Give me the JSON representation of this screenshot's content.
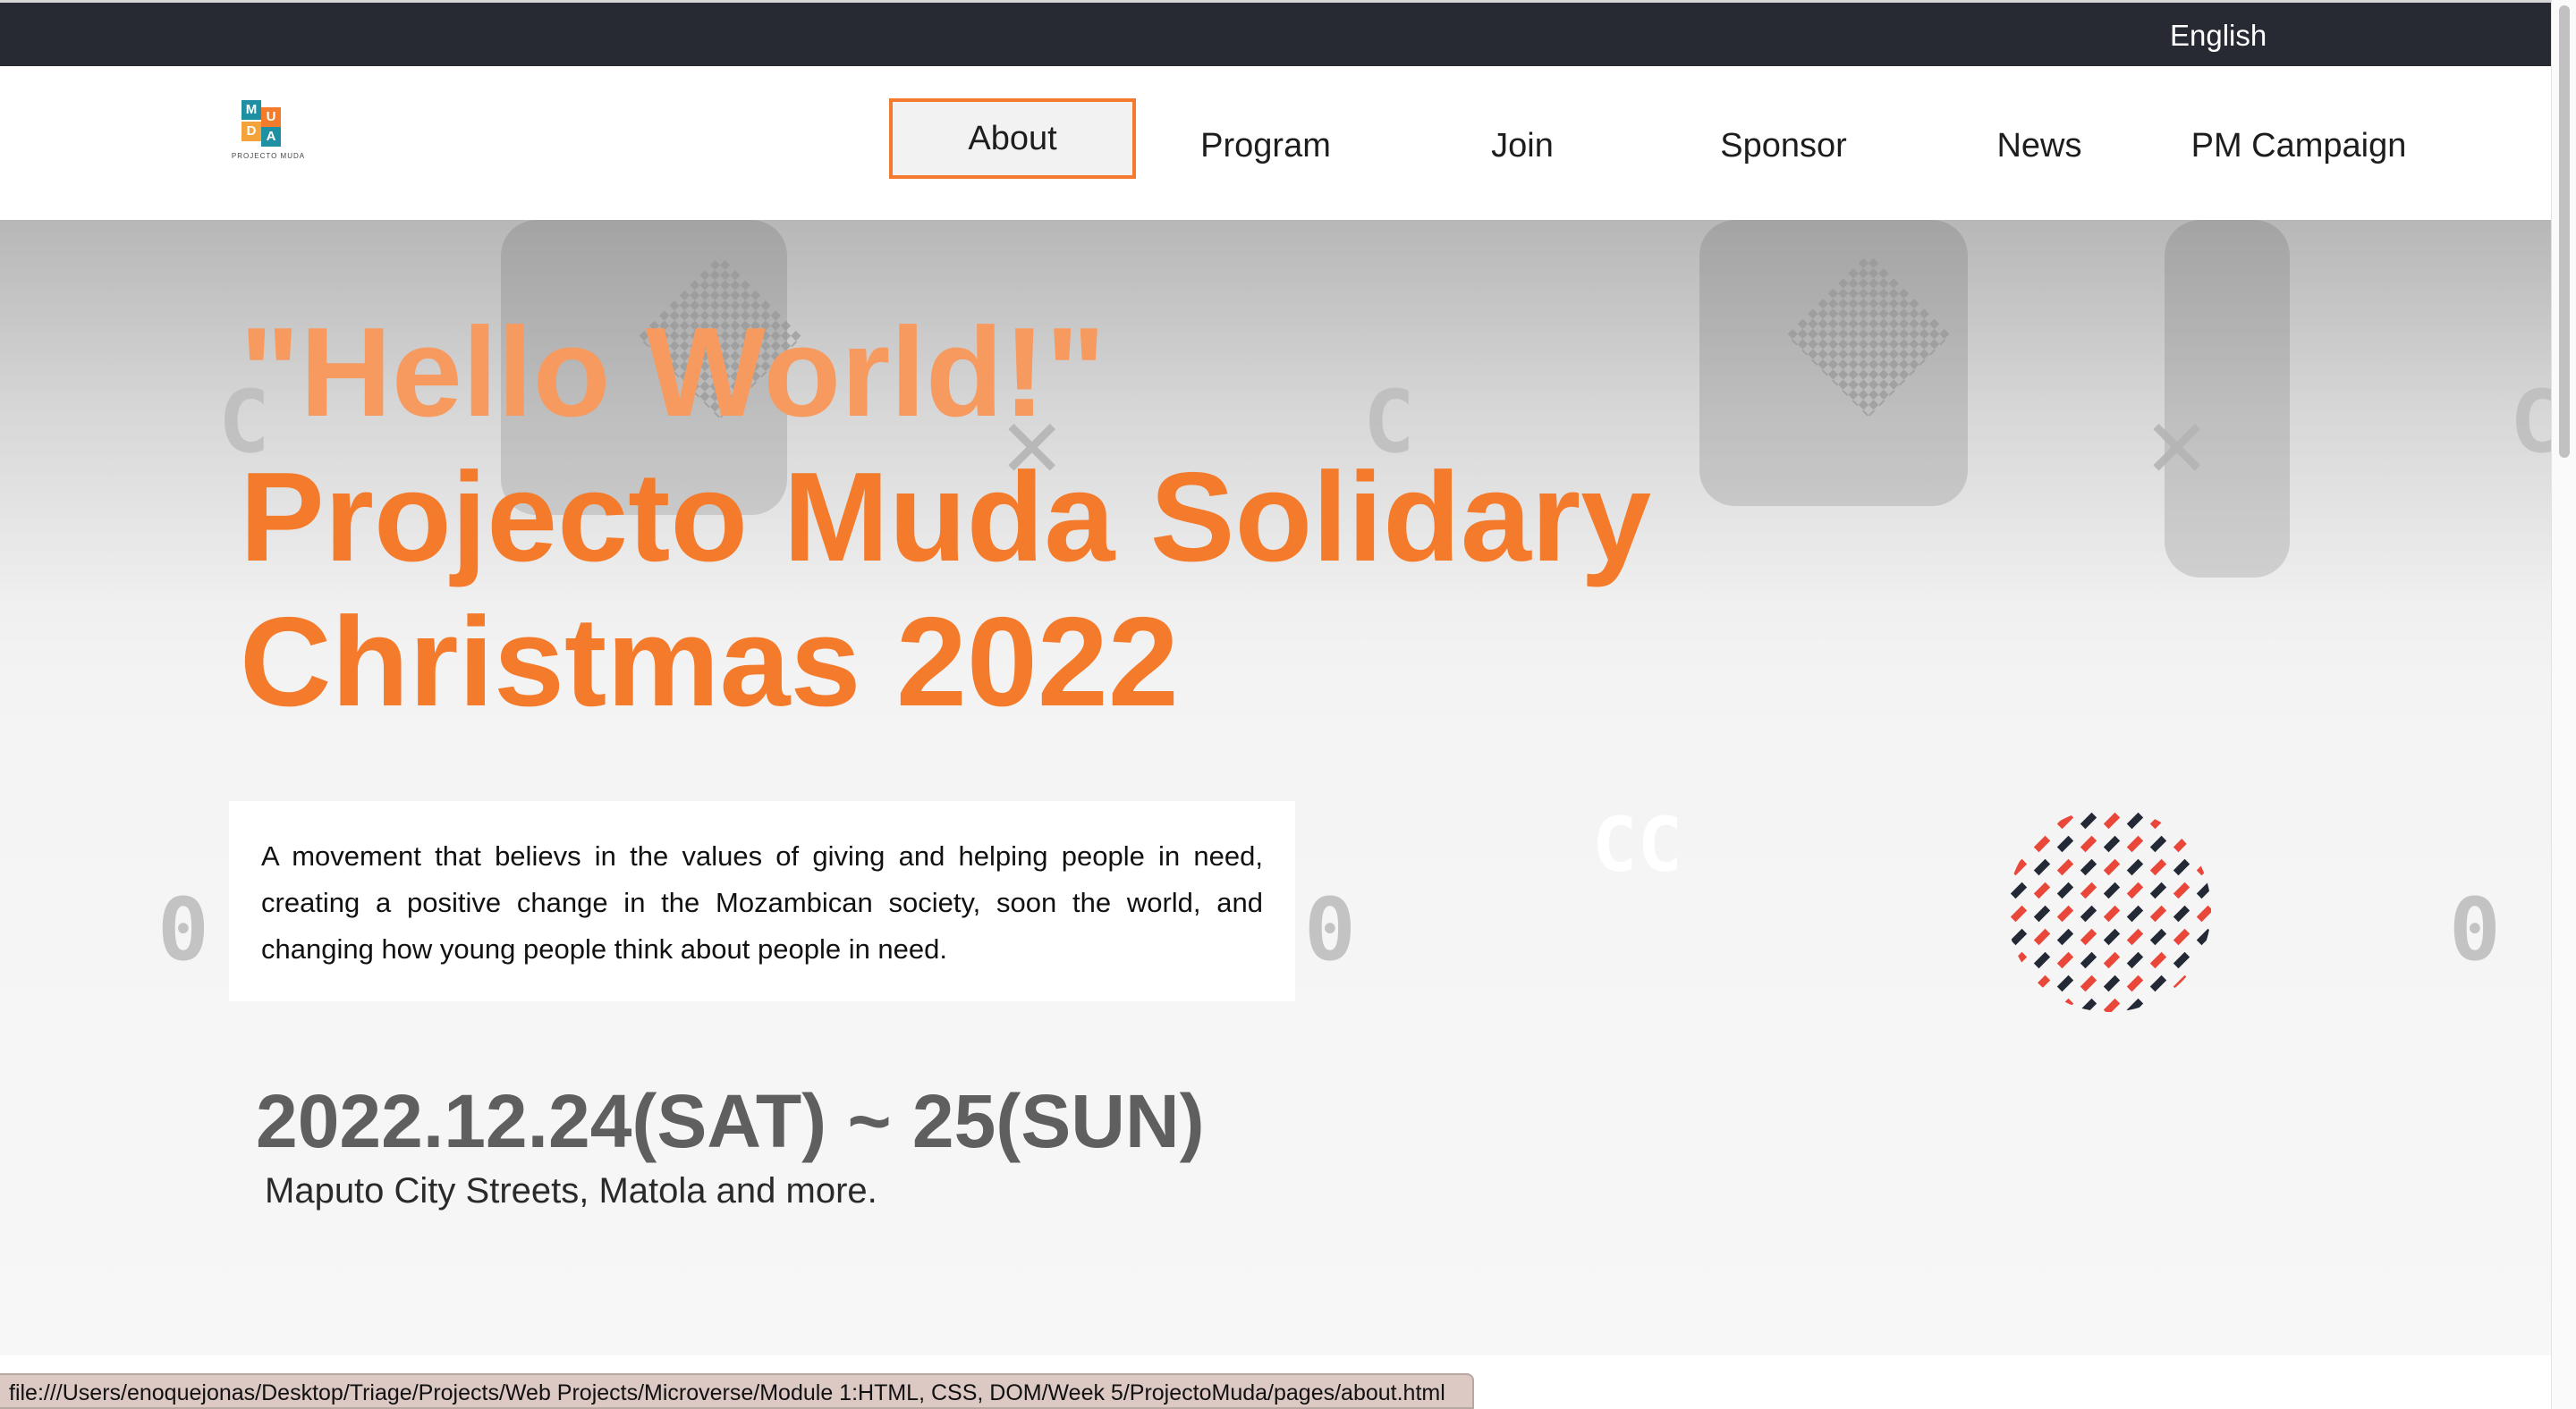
{
  "topbar": {
    "language": "English"
  },
  "logo": {
    "letters": [
      "M",
      "U",
      "D",
      "A"
    ],
    "caption": "PROJECTO MUDA"
  },
  "nav": {
    "items": [
      {
        "label": "About",
        "active": true
      },
      {
        "label": "Program"
      },
      {
        "label": "Join"
      },
      {
        "label": "Sponsor"
      },
      {
        "label": "News"
      },
      {
        "label": "PM Campaign"
      }
    ]
  },
  "hero": {
    "title_line1": "\"Hello World!\"",
    "title_line2": "Projecto Muda Solidary",
    "title_line3": "Christmas 2022",
    "description": "A movement that believs in the values of giving and helping people in need, creating a positive change in the Mozambican society, soon the world, and changing how young people think about people in need.",
    "date": "2022.12.24(SAT) ~ 25(SUN)",
    "location": "Maputo City Streets, Matola and more."
  },
  "status_bar": {
    "url": "file:///Users/enoquejonas/Desktop/Triage/Projects/Web Projects/Microverse/Module 1:HTML, CSS, DOM/Week 5/ProjectoMuda/pages/about.html"
  },
  "colors": {
    "accent": "#f47b2b",
    "topbar": "#272a33",
    "date_text": "#5f5f5f"
  }
}
